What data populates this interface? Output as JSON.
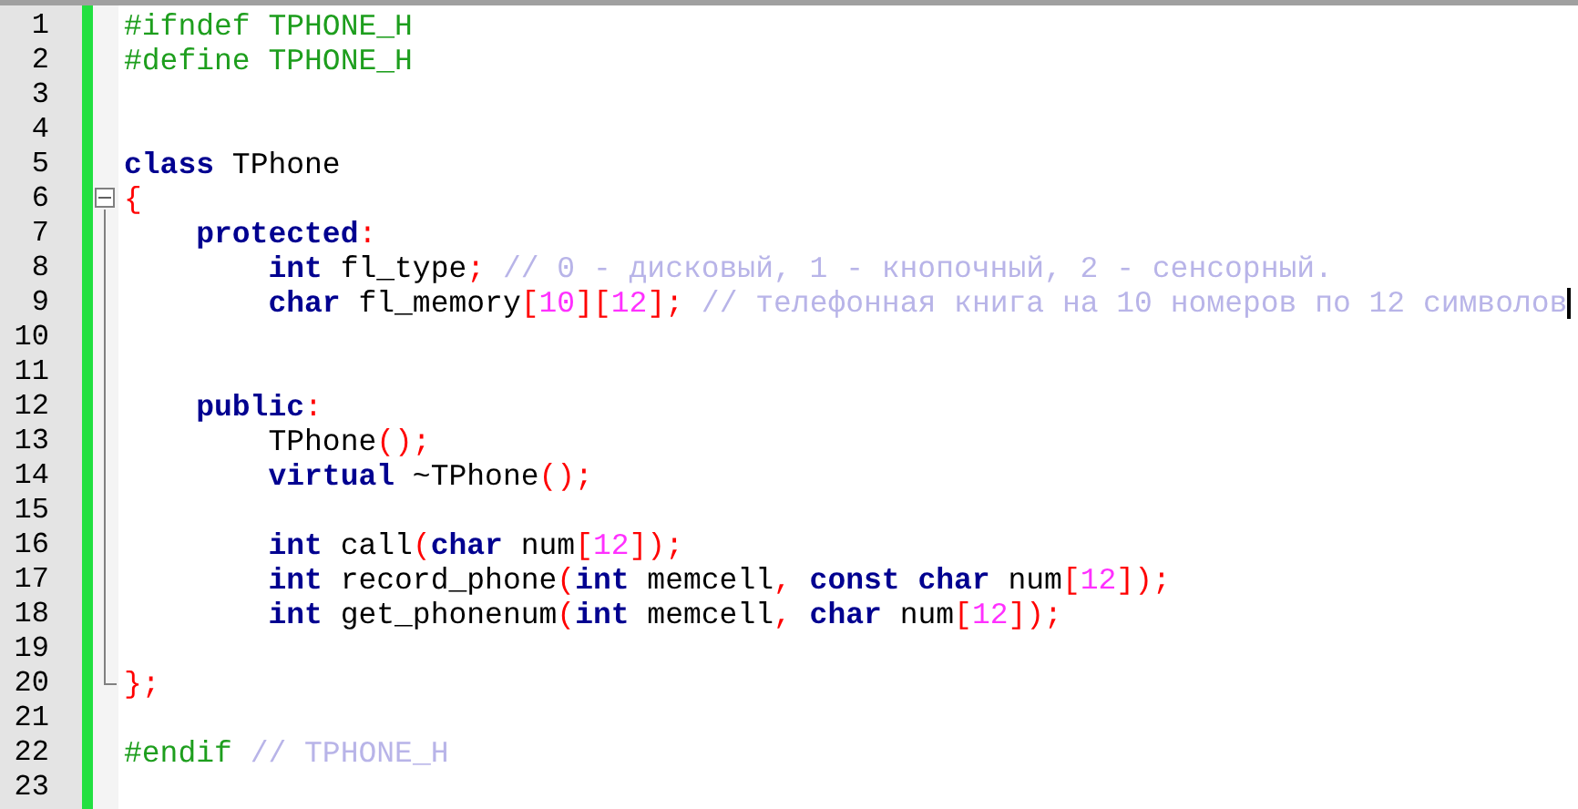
{
  "lines": [
    {
      "number": "1",
      "tokens": [
        {
          "kind": "pre",
          "text": "#ifndef TPHONE_H"
        }
      ]
    },
    {
      "number": "2",
      "tokens": [
        {
          "kind": "pre",
          "text": "#define TPHONE_H"
        }
      ]
    },
    {
      "number": "3"
    },
    {
      "number": "4"
    },
    {
      "number": "5",
      "tokens": [
        {
          "kind": "kw",
          "text": "class"
        },
        {
          "kind": "id",
          "text": " TPhone"
        }
      ]
    },
    {
      "number": "6",
      "fold_start": true,
      "expanded": true,
      "tokens": [
        {
          "kind": "op",
          "text": "{"
        }
      ]
    },
    {
      "number": "7",
      "tokens": [
        {
          "kind": "kw",
          "text": "    protected"
        },
        {
          "kind": "op",
          "text": ":"
        }
      ]
    },
    {
      "number": "8",
      "tokens": [
        {
          "kind": "kw",
          "text": "        int"
        },
        {
          "kind": "id",
          "text": " fl_type"
        },
        {
          "kind": "op",
          "text": ";"
        },
        {
          "kind": "comment",
          "text": " // 0 - дисковый, 1 - кнопочный, 2 - сенсорный."
        }
      ]
    },
    {
      "number": "9",
      "caret": true,
      "tokens": [
        {
          "kind": "kw",
          "text": "        char"
        },
        {
          "kind": "id",
          "text": " fl_memory"
        },
        {
          "kind": "op",
          "text": "["
        },
        {
          "kind": "num",
          "text": "10"
        },
        {
          "kind": "op",
          "text": "]["
        },
        {
          "kind": "num",
          "text": "12"
        },
        {
          "kind": "op",
          "text": "];"
        },
        {
          "kind": "comment",
          "text": " // телефонная книга на 10 номеров по 12 символов"
        }
      ]
    },
    {
      "number": "10"
    },
    {
      "number": "11"
    },
    {
      "number": "12",
      "tokens": [
        {
          "kind": "kw",
          "text": "    public"
        },
        {
          "kind": "op",
          "text": ":"
        }
      ]
    },
    {
      "number": "13",
      "tokens": [
        {
          "kind": "id",
          "text": "        TPhone"
        },
        {
          "kind": "op",
          "text": "();"
        }
      ]
    },
    {
      "number": "14",
      "tokens": [
        {
          "kind": "kw",
          "text": "        virtual"
        },
        {
          "kind": "id",
          "text": " ~TPhone"
        },
        {
          "kind": "op",
          "text": "();"
        }
      ]
    },
    {
      "number": "15"
    },
    {
      "number": "16",
      "tokens": [
        {
          "kind": "kw",
          "text": "        int"
        },
        {
          "kind": "id",
          "text": " call"
        },
        {
          "kind": "op",
          "text": "("
        },
        {
          "kind": "kw",
          "text": "char"
        },
        {
          "kind": "id",
          "text": " num"
        },
        {
          "kind": "op",
          "text": "["
        },
        {
          "kind": "num",
          "text": "12"
        },
        {
          "kind": "op",
          "text": "]);"
        }
      ]
    },
    {
      "number": "17",
      "tokens": [
        {
          "kind": "kw",
          "text": "        int"
        },
        {
          "kind": "id",
          "text": " record_phone"
        },
        {
          "kind": "op",
          "text": "("
        },
        {
          "kind": "kw",
          "text": "int"
        },
        {
          "kind": "id",
          "text": " memcell"
        },
        {
          "kind": "op",
          "text": ","
        },
        {
          "kind": "kw",
          "text": " const"
        },
        {
          "kind": "kw",
          "text": " char"
        },
        {
          "kind": "id",
          "text": " num"
        },
        {
          "kind": "op",
          "text": "["
        },
        {
          "kind": "num",
          "text": "12"
        },
        {
          "kind": "op",
          "text": "]);"
        }
      ]
    },
    {
      "number": "18",
      "tokens": [
        {
          "kind": "kw",
          "text": "        int"
        },
        {
          "kind": "id",
          "text": " get_phonenum"
        },
        {
          "kind": "op",
          "text": "("
        },
        {
          "kind": "kw",
          "text": "int"
        },
        {
          "kind": "id",
          "text": " memcell"
        },
        {
          "kind": "op",
          "text": ","
        },
        {
          "kind": "kw",
          "text": " char"
        },
        {
          "kind": "id",
          "text": " num"
        },
        {
          "kind": "op",
          "text": "["
        },
        {
          "kind": "num",
          "text": "12"
        },
        {
          "kind": "op",
          "text": "]);"
        }
      ]
    },
    {
      "number": "19"
    },
    {
      "number": "20",
      "fold_end": true,
      "tokens": [
        {
          "kind": "op",
          "text": "};"
        }
      ]
    },
    {
      "number": "21"
    },
    {
      "number": "22",
      "tokens": [
        {
          "kind": "pre",
          "text": "#endif"
        },
        {
          "kind": "comment",
          "text": " // TPHONE_H"
        }
      ]
    },
    {
      "number": "23"
    }
  ]
}
